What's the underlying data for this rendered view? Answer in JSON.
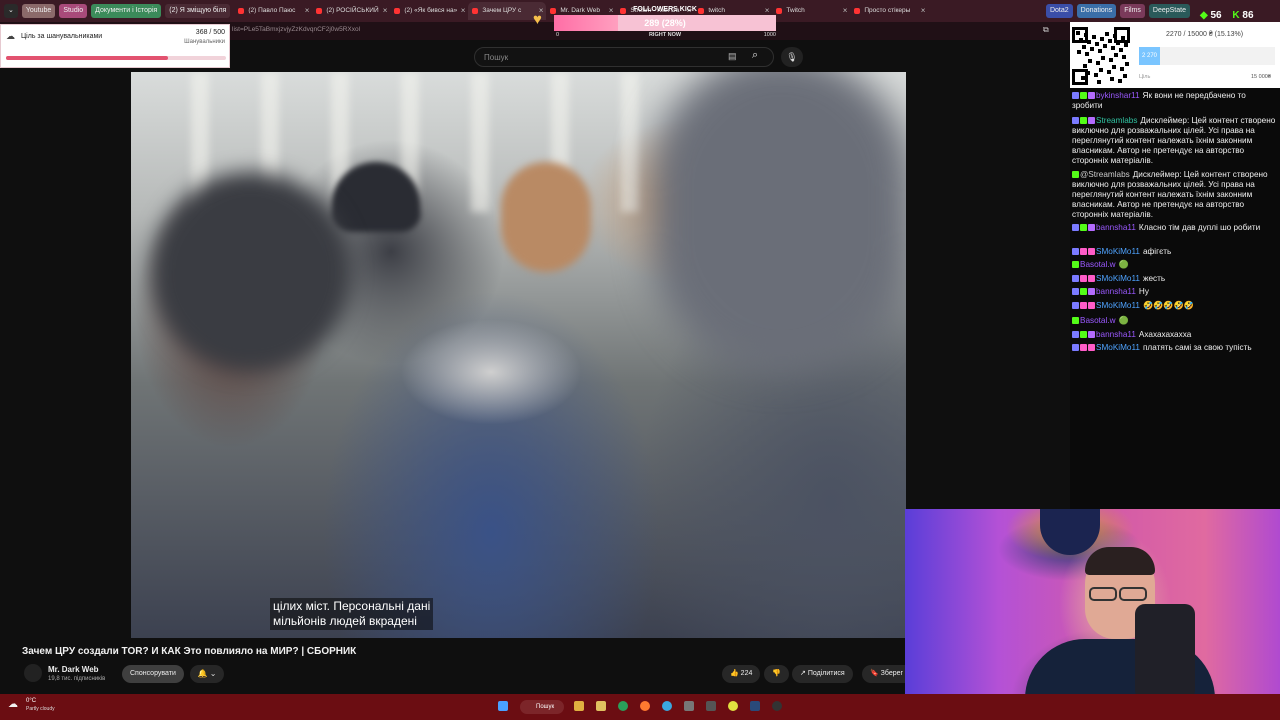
{
  "browser": {
    "bookmarks": [
      {
        "label": "Youtube",
        "color": "#8b6a6a"
      },
      {
        "label": "Studio",
        "color": "#a84a7a"
      },
      {
        "label": "Документи і Історія",
        "color": "#3b8b5a"
      },
      {
        "label": "(2) Я зміщую біля",
        "color": "#4a2a34"
      }
    ],
    "tabs": [
      {
        "label": "(2) Павло Паюс",
        "active": false
      },
      {
        "label": "(2) РОСІЙСЬКИЙ",
        "active": false
      },
      {
        "label": "(2) «Як бився на»",
        "active": false
      },
      {
        "label": "Зачем ЦРУ с",
        "active": true
      },
      {
        "label": "Mr. Dark Web",
        "active": false
      },
      {
        "label": "Stream - Kick Da",
        "active": false
      },
      {
        "label": "twitch",
        "active": false
      },
      {
        "label": "Twitch",
        "active": false
      },
      {
        "label": "Просто стікеры",
        "active": false
      }
    ],
    "right_bookmarks": [
      {
        "label": "Dota2",
        "color": "#3a4ea8"
      },
      {
        "label": "Donations",
        "color": "#3a6ea8"
      },
      {
        "label": "Films",
        "color": "#7a3a5a"
      },
      {
        "label": "DeepState",
        "color": "#2a5a5a"
      }
    ],
    "url": "list=PLe5TaBmxjzvjyZzKdvqnCF2j0w5RXxol"
  },
  "youtube": {
    "search_placeholder": "Пошук",
    "subtitle_line1": "цілих міст. Персональні дані",
    "subtitle_line2": "мільйонів людей вкрадені",
    "video_title": "Зачем ЦРУ создали TOR? И КАК Это повлияло на МИР? | СБОРНИК",
    "channel_name": "Mr. Dark Web",
    "subscribers": "19,8 тис. підписників",
    "sponsor_label": "Спонсорувати",
    "likes": "224",
    "share_label": "Поділитися",
    "save_label": "Зберег"
  },
  "goal_widget": {
    "label": "Ціль за шанувальниками",
    "count": "368 / 500",
    "sublabel": "Шанувальники",
    "progress": 0.736
  },
  "followers_widget": {
    "title": "FOLLOWERS KICK",
    "value": "289 (28%)",
    "progress": 0.289,
    "min": "0",
    "mid": "RIGHT NOW",
    "max": "1000"
  },
  "donation_widget": {
    "label": "2270 / 15000 ₴ (15.13%)",
    "bar_text": "2 270",
    "progress": 0.1513,
    "left_caption": "Ціль",
    "right_caption": "15 000₴"
  },
  "kick_stats": {
    "a": "56",
    "b": "86"
  },
  "chat": [
    {
      "user": "bykinshar11",
      "user_color": "#9b59ff",
      "text": "Як вони не передбачено то зробити",
      "badges": [
        "#7a7aff",
        "#53fc18",
        "#b46bff"
      ]
    },
    {
      "user": "Streamlabs",
      "user_color": "#31c3a2",
      "text": "Дисклеймер: Цей контент створено виключно для розважальних цілей. Усі права на переглянутий контент належать їхнім законним власникам. Автор не претендує на авторство сторонніх матеріалів.",
      "badges": [
        "#7a7aff",
        "#53fc18",
        "#b46bff"
      ]
    },
    {
      "user": "@Streamlabs",
      "user_color": "#cccccc",
      "text": "Дисклеймер: Цей контент створено виключно для розважальних цілей. Усі права на переглянутий контент належать їхнім законним власникам. Автор не претендує на авторство сторонніх матеріалів.",
      "badges": [
        "#53fc18"
      ]
    },
    {
      "user": "bannsha11",
      "user_color": "#9b59ff",
      "text": "Класно тім дав дуплі шо робити",
      "badges": [
        "#7a7aff",
        "#53fc18",
        "#b46bff"
      ]
    },
    {
      "user": "SMoKiMo11",
      "user_color": "#4fa3ff",
      "text": "афігєть",
      "badges": [
        "#7a7aff",
        "#ff5cc8",
        "#ff5cc8"
      ]
    },
    {
      "user": "Basotal.w",
      "user_color": "#9b59ff",
      "text": "🟢",
      "badges": [
        "#53fc18"
      ]
    },
    {
      "user": "SMoKiMo11",
      "user_color": "#4fa3ff",
      "text": "жесть",
      "badges": [
        "#7a7aff",
        "#ff5cc8",
        "#ff5cc8"
      ]
    },
    {
      "user": "bannsha11",
      "user_color": "#9b59ff",
      "text": "Ну",
      "badges": [
        "#7a7aff",
        "#53fc18",
        "#b46bff"
      ]
    },
    {
      "user": "SMoKiMo11",
      "user_color": "#4fa3ff",
      "text": "🤣🤣🤣🤣🤣",
      "badges": [
        "#7a7aff",
        "#ff5cc8",
        "#ff5cc8"
      ]
    },
    {
      "user": "Basotal.w",
      "user_color": "#9b59ff",
      "text": "🟢",
      "badges": [
        "#53fc18"
      ]
    },
    {
      "user": "bannsha11",
      "user_color": "#9b59ff",
      "text": "Ахахахахахха",
      "badges": [
        "#7a7aff",
        "#53fc18",
        "#b46bff"
      ]
    },
    {
      "user": "SMoKiMo11",
      "user_color": "#4fa3ff",
      "text": "платять самі за свою тупість",
      "badges": [
        "#7a7aff",
        "#ff5cc8",
        "#ff5cc8"
      ]
    }
  ],
  "taskbar": {
    "weather_temp": "0°C",
    "weather_desc": "Partly cloudy",
    "search_label": "Пошук",
    "icons": [
      "windows-icon",
      "file-explorer-icon",
      "edge-icon",
      "firefox-icon",
      "telegram-icon",
      "calculator-icon",
      "chrome-icon",
      "steam-icon",
      "obs-icon"
    ]
  }
}
